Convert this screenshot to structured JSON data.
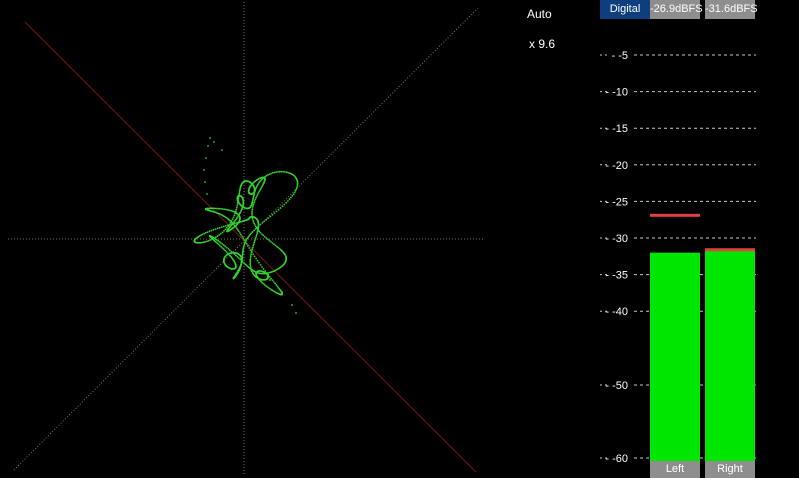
{
  "scope": {
    "trace_color": "#33d42c",
    "axis_color": "#7a7a64",
    "diag_color": "#7a1515"
  },
  "controls": {
    "auto_label": "Auto",
    "zoom_label": "x 9.6"
  },
  "meter": {
    "mode_label": "Digital",
    "left_peak_label": "-26.9dBFS",
    "right_peak_label": "-31.6dBFS",
    "scale": [
      -5,
      -10,
      -15,
      -20,
      -25,
      -30,
      -35,
      -40,
      -50,
      -60
    ],
    "left_channel_label": "Left",
    "right_channel_label": "Right",
    "left_level": -32,
    "right_level": -31.6,
    "left_peak_hold": -26.9,
    "right_peak_hold": -31.6,
    "level_color": "#00e600",
    "peak_color": "#e04040"
  }
}
